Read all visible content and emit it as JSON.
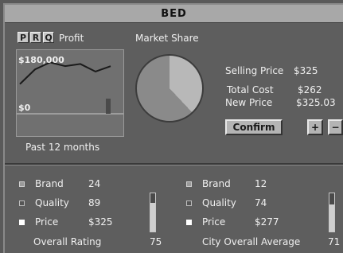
{
  "window": {
    "title": "BED"
  },
  "tabs": [
    {
      "label": "P"
    },
    {
      "label": "R"
    },
    {
      "label": "Q"
    }
  ],
  "profit_panel": {
    "title": "Profit",
    "y_max_label": "$180,000",
    "y_min_label": "$0",
    "period_label": "Past 12 months",
    "series": [
      0.55,
      0.82,
      0.95,
      0.88,
      0.92,
      0.78,
      0.88
    ],
    "current_bar": 0.28
  },
  "market_share": {
    "title": "Market Share",
    "slices": [
      0.62,
      0.38
    ],
    "colors": [
      "#8a8a8a",
      "#b8b8b8"
    ]
  },
  "pricing": {
    "selling_price_label": "Selling Price",
    "selling_price_value": "$325",
    "total_cost_label": "Total Cost",
    "total_cost_value": "$262",
    "new_price_label": "New Price",
    "new_price_value": "$325.03",
    "confirm_label": "Confirm",
    "plus_label": "+",
    "minus_label": "−"
  },
  "own_rating": {
    "brand_label": "Brand",
    "brand_value": "24",
    "quality_label": "Quality",
    "quality_value": "89",
    "price_label": "Price",
    "price_value": "$325",
    "overall_label": "Overall Rating",
    "overall_value": "75",
    "gauge_level": 0.75
  },
  "city_rating": {
    "brand_label": "Brand",
    "brand_value": "12",
    "quality_label": "Quality",
    "quality_value": "74",
    "price_label": "Price",
    "price_value": "$277",
    "overall_label": "City Overall Average",
    "overall_value": "71",
    "gauge_level": 0.71
  }
}
